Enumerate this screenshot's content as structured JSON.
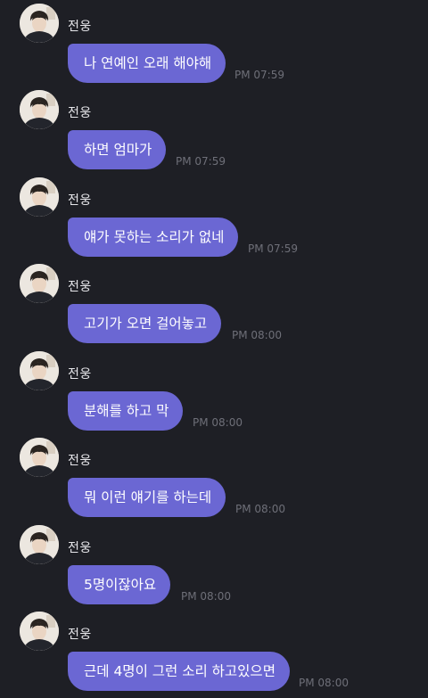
{
  "chat": {
    "messages": [
      {
        "sender": "전웅",
        "text": "나 연예인 오래 해야해",
        "time": "PM 07:59",
        "avatar_icon": "profile-photo-icon"
      },
      {
        "sender": "전웅",
        "text": "하면 엄마가",
        "time": "PM 07:59",
        "avatar_icon": "profile-photo-icon"
      },
      {
        "sender": "전웅",
        "text": "얘가 못하는 소리가 없네",
        "time": "PM 07:59",
        "avatar_icon": "profile-photo-icon"
      },
      {
        "sender": "전웅",
        "text": "고기가 오면 걸어놓고",
        "time": "PM 08:00",
        "avatar_icon": "profile-photo-icon"
      },
      {
        "sender": "전웅",
        "text": "분해를 하고 막",
        "time": "PM 08:00",
        "avatar_icon": "profile-photo-icon"
      },
      {
        "sender": "전웅",
        "text": "뭐 이런 얘기를 하는데",
        "time": "PM 08:00",
        "avatar_icon": "profile-photo-icon"
      },
      {
        "sender": "전웅",
        "text": "5명이잖아요",
        "time": "PM 08:00",
        "avatar_icon": "profile-photo-icon"
      },
      {
        "sender": "전웅",
        "text": "근데 4명이 그런 소리 하고있으면",
        "time": "PM 08:00",
        "avatar_icon": "profile-photo-icon"
      }
    ]
  },
  "colors": {
    "background": "#1e1f25",
    "bubble": "#6b67d3",
    "bubble_text": "#ffffff",
    "sender_text": "#e6e6ea",
    "time_text": "#6e6f78"
  }
}
